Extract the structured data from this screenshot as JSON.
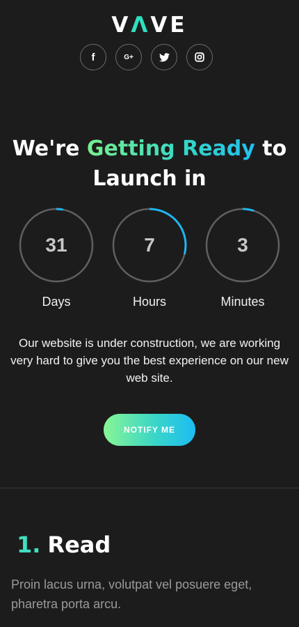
{
  "brand": {
    "logo_part1": "V",
    "logo_accent": "Λ",
    "logo_part2": "VE"
  },
  "socials": [
    {
      "icon": "facebook-icon",
      "glyph": "f"
    },
    {
      "icon": "google-plus-icon",
      "glyph": "G+"
    },
    {
      "icon": "twitter-icon",
      "glyph": ""
    },
    {
      "icon": "instagram-icon",
      "glyph": ""
    }
  ],
  "headline": {
    "part1": "We're ",
    "highlight": "Getting Ready",
    "part2": " to",
    "line2": "Launch in"
  },
  "countdown": [
    {
      "value": "31",
      "label": "Days",
      "progress": 0.03
    },
    {
      "value": "7",
      "label": "Hours",
      "progress": 0.29
    },
    {
      "value": "3",
      "label": "Minutes",
      "progress": 0.05
    }
  ],
  "description": "Our website is under construction, we are working very hard to give you the best experience on our new web site.",
  "cta": {
    "label": "NOTIFY ME"
  },
  "section": {
    "number": "1.",
    "title": "Read",
    "body": "Proin lacus urna, volutpat vel posuere eget, pharetra porta arcu."
  },
  "colors": {
    "background": "#1c1c1c",
    "accent": "#2fe0c0",
    "progress": "#1fb6f0",
    "ring_track": "#5f5f5f"
  }
}
